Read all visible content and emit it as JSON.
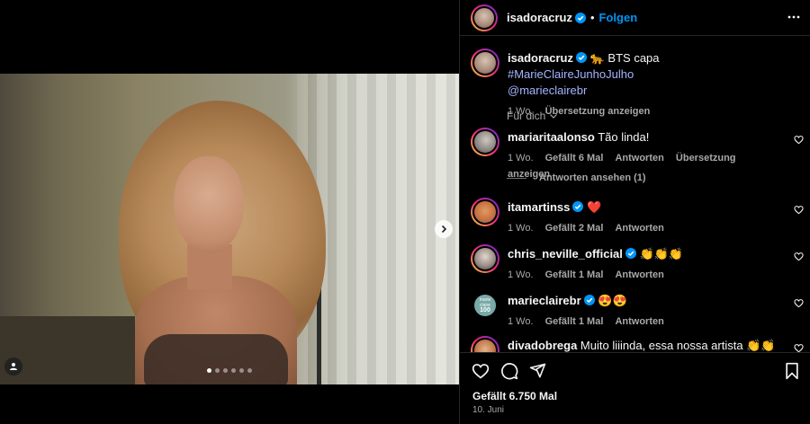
{
  "post_header": {
    "username": "isadoracruz",
    "separator": "•",
    "follow_label": "Folgen"
  },
  "caption": {
    "username": "isadoracruz",
    "emoji": "🐆",
    "text": "BTS capa",
    "hashtag": "#MarieClaireJunhoJulho",
    "mention": "@marieclairebr",
    "time": "1 Wo.",
    "translate": "Übersetzung anzeigen"
  },
  "sort_label": "Für dich",
  "comments": [
    {
      "username": "mariaritaalonso",
      "verified": false,
      "text": "Tão linda!",
      "time": "1 Wo.",
      "likes": "Gefällt 6 Mal",
      "reply": "Antworten",
      "translate": "Übersetzung anzeigen"
    },
    {
      "username": "itamartinss",
      "verified": true,
      "text": "❤️",
      "time": "1 Wo.",
      "likes": "Gefällt 2 Mal",
      "reply": "Antworten"
    },
    {
      "username": "chris_neville_official",
      "verified": true,
      "text": "👏👏👏",
      "time": "1 Wo.",
      "likes": "Gefällt 1 Mal",
      "reply": "Antworten"
    },
    {
      "username": "marieclairebr",
      "verified": true,
      "text": "😍😍",
      "time": "1 Wo.",
      "likes": "Gefällt 1 Mal",
      "reply": "Antworten"
    },
    {
      "username": "divadobrega",
      "verified": false,
      "text": "Muito liiinda, essa nossa artista 👏👏👏👏👏",
      "time": "",
      "likes": "",
      "reply": ""
    }
  ],
  "replies_label": "Antworten ansehen (1)",
  "marieclaire_avatar": {
    "line1": "marie",
    "line2": "claire",
    "line3": "100"
  },
  "likes_total": "Gefällt 6.750 Mal",
  "post_date": "10. Juni",
  "carousel": {
    "slides": 6,
    "active_index": 0
  },
  "colors": {
    "accent": "#0095f6",
    "hashtag": "#a6b4ff",
    "muted": "#a8a8a8",
    "background": "#000000"
  },
  "icons": [
    "more-icon",
    "chevron-right-icon",
    "user-tag-icon",
    "heart-icon",
    "comment-icon",
    "share-icon",
    "bookmark-icon",
    "verified-icon",
    "chevron-down-icon"
  ]
}
